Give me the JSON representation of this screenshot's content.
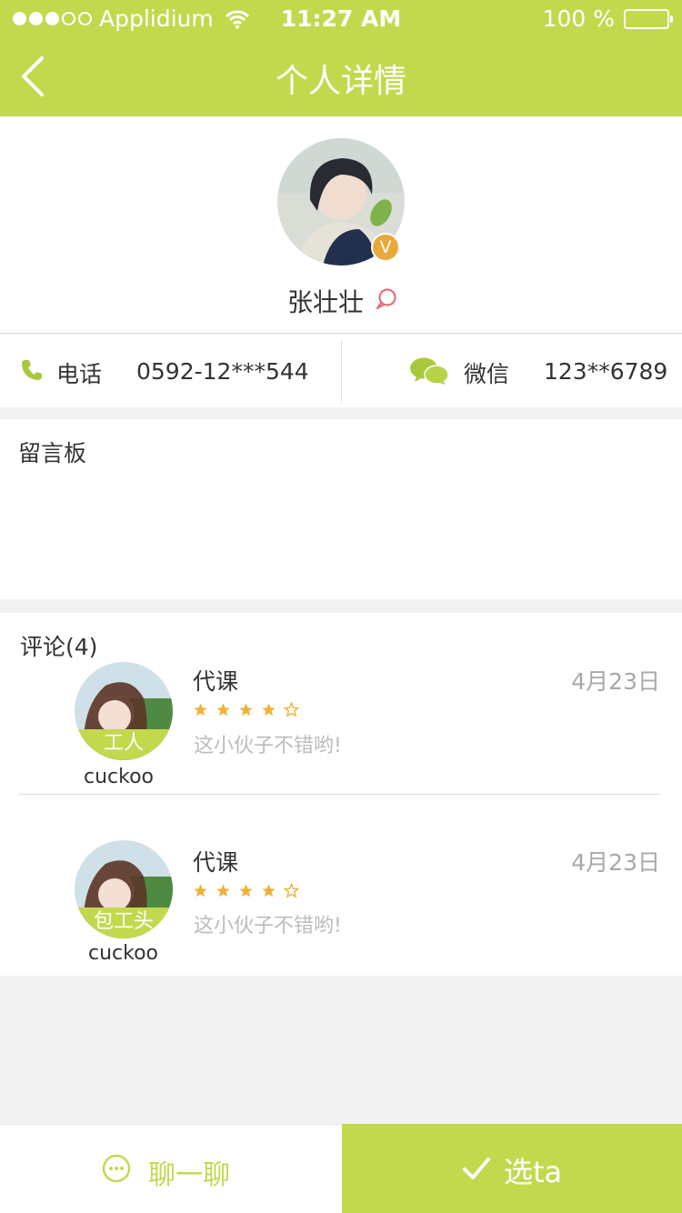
{
  "status_bar": {
    "carrier": "Applidium",
    "time": "11:27 AM",
    "battery": "100 %",
    "signal_bars_filled": 3,
    "signal_bars_total": 5
  },
  "nav": {
    "title": "个人详情",
    "back_icon": "chevron-left-icon"
  },
  "profile": {
    "name": "张壮壮",
    "verified_badge": "V",
    "message_icon": "chat-bubble-icon"
  },
  "contact": {
    "phone_label": "电话",
    "phone_value": "0592-12***544",
    "wechat_label": "微信",
    "wechat_value": "123**6789"
  },
  "board": {
    "title": "留言板"
  },
  "comments": {
    "title": "评论(4)",
    "items": [
      {
        "role": "工人",
        "user": "cuckoo",
        "service": "代课",
        "date": "4月23日",
        "rating": 4,
        "max_rating": 5,
        "text": "这小伙子不错哟!"
      },
      {
        "role": "包工头",
        "user": "cuckoo",
        "service": "代课",
        "date": "4月23日",
        "rating": 4,
        "max_rating": 5,
        "text": "这小伙子不错哟!"
      }
    ]
  },
  "bottom": {
    "chat_label": "聊一聊",
    "pick_label": "选ta"
  },
  "colors": {
    "accent": "#c2d94e",
    "star": "#f0b13c",
    "badge": "#e8a93a"
  }
}
